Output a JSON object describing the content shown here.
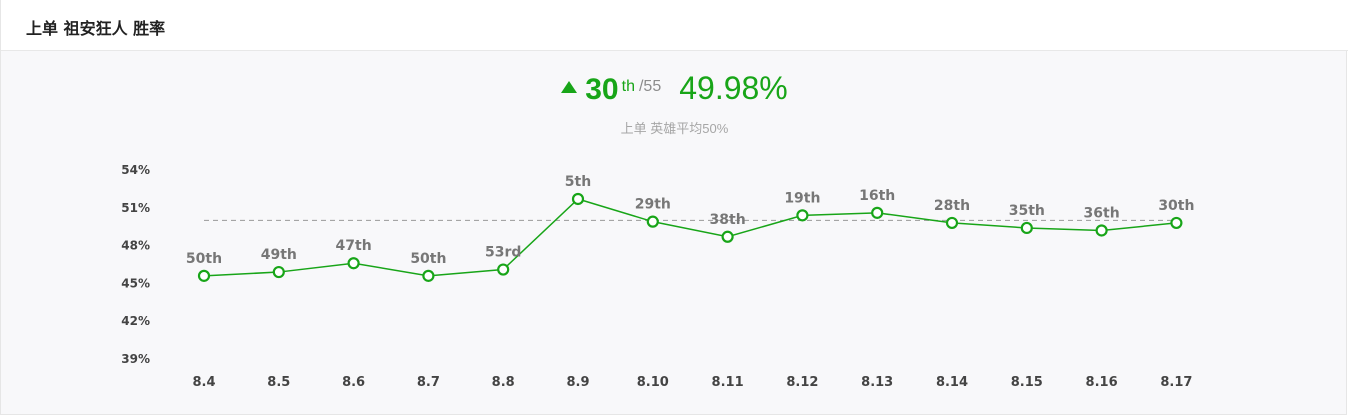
{
  "header": {
    "title": "上单 祖安狂人 胜率"
  },
  "summary": {
    "rank": "30",
    "rank_suffix": "th",
    "rank_total": "/55",
    "winrate": "49.98%",
    "subtitle": "上单 英雄平均50%",
    "trend": "up",
    "accent_color": "#18a518"
  },
  "chart_data": {
    "type": "line",
    "title": "",
    "xlabel": "",
    "ylabel": "",
    "categories": [
      "8.4",
      "8.5",
      "8.6",
      "8.7",
      "8.8",
      "8.9",
      "8.10",
      "8.11",
      "8.12",
      "8.13",
      "8.14",
      "8.15",
      "8.16",
      "8.17"
    ],
    "series": [
      {
        "values": [
          45.6,
          45.9,
          46.6,
          45.6,
          46.1,
          51.7,
          49.9,
          48.7,
          50.4,
          50.6,
          49.8,
          49.4,
          49.2,
          49.8
        ],
        "point_labels": [
          "50th",
          "49th",
          "47th",
          "50th",
          "53rd",
          "5th",
          "29th",
          "38th",
          "19th",
          "16th",
          "28th",
          "35th",
          "36th",
          "30th"
        ],
        "color": "#18a518"
      }
    ],
    "reference_line": 50,
    "reference_color": "#999999",
    "ylim": [
      39,
      54
    ],
    "yticks": [
      54,
      51,
      48,
      45,
      42,
      39
    ],
    "ytick_labels": [
      "54%",
      "51%",
      "48%",
      "45%",
      "42%",
      "39%"
    ],
    "grid": false
  }
}
